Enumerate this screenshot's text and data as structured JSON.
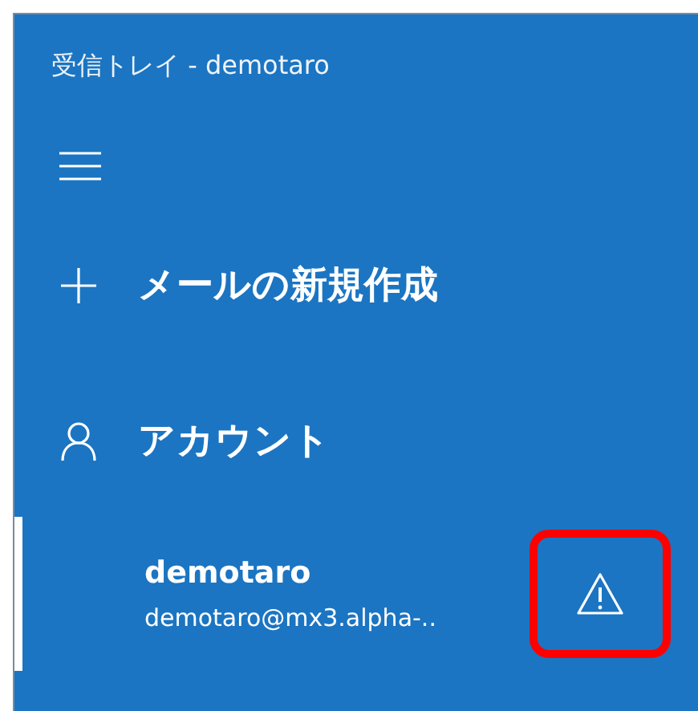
{
  "window": {
    "title": "受信トレイ - demotaro"
  },
  "new_mail": {
    "label": "メールの新規作成"
  },
  "accounts": {
    "label": "アカウント",
    "items": [
      {
        "name": "demotaro",
        "email": "demotaro@mx3.alpha-..",
        "selected": true,
        "warning": true,
        "highlighted": true
      }
    ]
  }
}
